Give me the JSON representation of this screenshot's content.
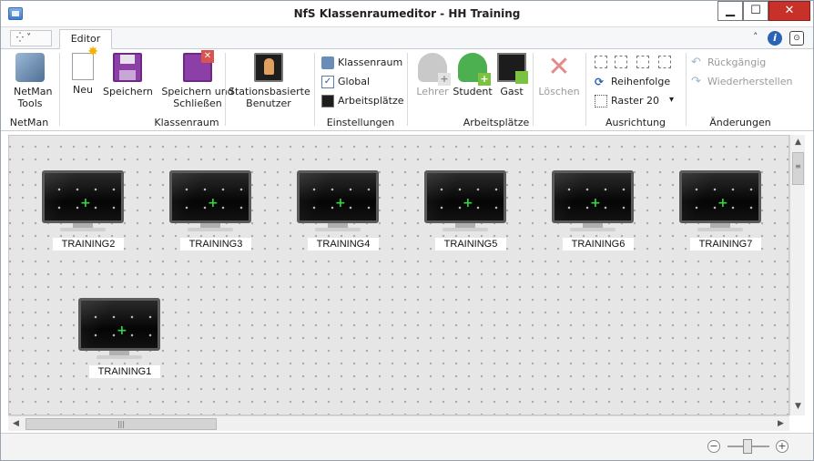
{
  "window": {
    "title": "NfS Klassenraumeditor - HH Training",
    "minimize": "▁",
    "maximize": "☐",
    "close": "✕"
  },
  "tabs": {
    "quick_access": "⁛ ˅",
    "active": "Editor",
    "collapse": "˄",
    "help": "i",
    "pin": "⊙"
  },
  "ribbon": {
    "groups": {
      "netman": {
        "label": "NetMan",
        "buttons": {
          "tools": "NetMan Tools"
        }
      },
      "klassenraum": {
        "label": "Klassenraum",
        "buttons": {
          "neu": "Neu",
          "speichern": "Speichern",
          "speichern_schliessen": "Speichern und Schließen",
          "stationsbasierte": "Stationsbasierte Benutzer"
        }
      },
      "einstellungen": {
        "label": "Einstellungen",
        "items": [
          "Klassenraum",
          "Global",
          "Arbeitsplätze"
        ]
      },
      "arbeitsplaetze": {
        "label": "Arbeitsplätze",
        "buttons": {
          "lehrer": "Lehrer",
          "student": "Student",
          "gast": "Gast",
          "loeschen": "Löschen"
        }
      },
      "ausrichtung": {
        "label": "Ausrichtung",
        "reihenfolge": "Reihenfolge",
        "raster": "Raster 20",
        "raster_dropdown": "▾"
      },
      "aenderungen": {
        "label": "Änderungen",
        "rueckgaengig": "Rückgängig",
        "wiederherstellen": "Wiederherstellen"
      }
    }
  },
  "stations": [
    {
      "label": "TRAINING2"
    },
    {
      "label": "TRAINING3"
    },
    {
      "label": "TRAINING4"
    },
    {
      "label": "TRAINING5"
    },
    {
      "label": "TRAINING6"
    },
    {
      "label": "TRAINING7"
    },
    {
      "label": "TRAINING1"
    }
  ],
  "scrollbars": {
    "up": "▲",
    "down": "▼",
    "left": "◀",
    "right": "▶",
    "hthumb_grip": "|||",
    "vthumb_grip": "≡"
  },
  "statusbar": {
    "zoom_out": "−",
    "zoom_in": "+"
  }
}
